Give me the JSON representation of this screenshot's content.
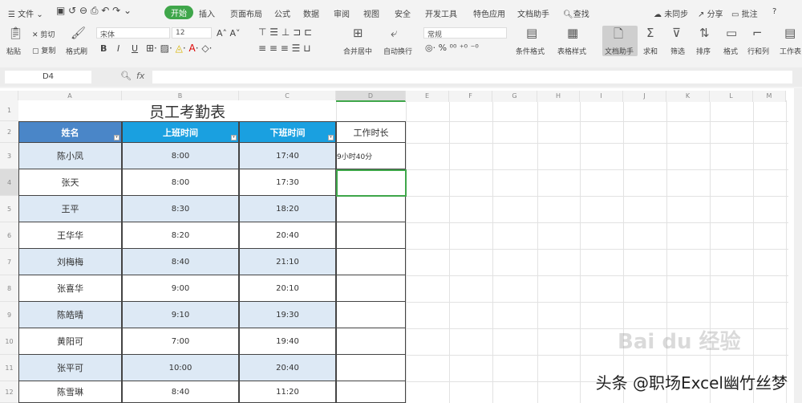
{
  "menubar": {
    "file": "文件",
    "tabs": [
      "开始",
      "插入",
      "页面布局",
      "公式",
      "数据",
      "审阅",
      "视图",
      "安全",
      "开发工具",
      "特色应用",
      "文档助手"
    ],
    "active_tab": "开始",
    "search": "查找",
    "right": [
      "未同步",
      "分享",
      "批注"
    ],
    "help": "?"
  },
  "ribbon": {
    "paste": "粘贴",
    "cut": "剪切",
    "copy": "复制",
    "format_painter": "格式刷",
    "font_name": "宋体",
    "font_size": "12",
    "bold": "B",
    "italic": "I",
    "underline": "U",
    "merge": "合并居中",
    "wrap": "自动换行",
    "number_format": "常规",
    "cond_format": "条件格式",
    "table_style": "表格样式",
    "doc_helper": "文档助手",
    "sum": "求和",
    "filter": "筛选",
    "sort": "排序",
    "format": "格式",
    "rowcol": "行和列",
    "sheet": "工作表"
  },
  "formula_bar": {
    "name_box": "D4",
    "fx": "fx",
    "value": ""
  },
  "columns": [
    "A",
    "B",
    "C",
    "D",
    "E",
    "F",
    "G",
    "H",
    "I",
    "J",
    "K",
    "L",
    "M"
  ],
  "rows": [
    "1",
    "2",
    "3",
    "4",
    "5",
    "6",
    "7",
    "8",
    "9",
    "10",
    "11",
    "12"
  ],
  "sheet": {
    "title": "员工考勤表",
    "headers": [
      "姓名",
      "上班时间",
      "下班时间",
      "工作时长"
    ],
    "records": [
      {
        "name": "陈小凤",
        "start": "8:00",
        "end": "17:40",
        "duration": "9小时40分"
      },
      {
        "name": "张天",
        "start": "8:00",
        "end": "17:30",
        "duration": ""
      },
      {
        "name": "王平",
        "start": "8:30",
        "end": "18:20",
        "duration": ""
      },
      {
        "name": "王华华",
        "start": "8:20",
        "end": "20:40",
        "duration": ""
      },
      {
        "name": "刘梅梅",
        "start": "8:40",
        "end": "21:10",
        "duration": ""
      },
      {
        "name": "张喜华",
        "start": "9:00",
        "end": "20:10",
        "duration": ""
      },
      {
        "name": "陈皓晴",
        "start": "9:10",
        "end": "19:30",
        "duration": ""
      },
      {
        "name": "黄阳可",
        "start": "7:00",
        "end": "19:40",
        "duration": ""
      },
      {
        "name": "张平可",
        "start": "10:00",
        "end": "20:40",
        "duration": ""
      },
      {
        "name": "陈雪琳",
        "start": "8:40",
        "end": "11:20",
        "duration": ""
      }
    ],
    "selected_cell": "D4"
  },
  "colors": {
    "accent": "#3fa64a",
    "header_a": "#4a86c8",
    "header_bc": "#1aa0e0",
    "band": "#dde9f5",
    "selection": "#3fa64a"
  },
  "watermark": "头条 @职场Excel幽竹丝梦",
  "baidu_watermark": "Bai du 经验"
}
